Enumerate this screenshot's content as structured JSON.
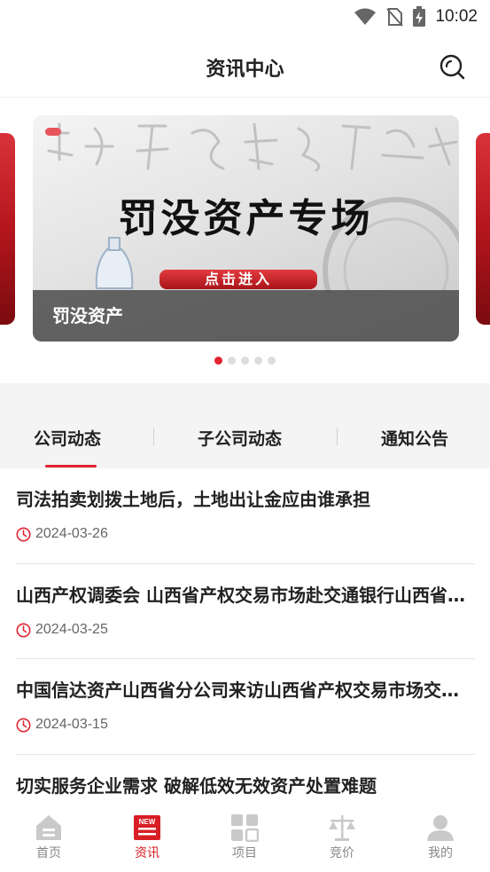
{
  "status_bar": {
    "time": "10:02"
  },
  "header": {
    "title": "资讯中心"
  },
  "banner": {
    "headline": "罚没资产专场",
    "button_text": "点击进入",
    "caption": "罚没资产",
    "slide_count": 5,
    "active_slide": 1
  },
  "tabs": [
    {
      "label": "公司动态",
      "active": true
    },
    {
      "label": "子公司动态",
      "active": false
    },
    {
      "label": "通知公告",
      "active": false
    }
  ],
  "news": [
    {
      "title": "司法拍卖划拨土地后，土地出让金应由谁承担",
      "date": "2024-03-26"
    },
    {
      "title": "山西产权调委会 山西省产权交易市场赴交通银行山西省分行",
      "date": "2024-03-25"
    },
    {
      "title": "中国信达资产山西省分公司来访山西省产权交易市场交流座谈",
      "date": "2024-03-15"
    },
    {
      "title": "切实服务企业需求 破解低效无效资产处置难题",
      "date": ""
    }
  ],
  "tabbar": [
    {
      "label": "首页",
      "icon": "home-icon",
      "active": false
    },
    {
      "label": "资讯",
      "icon": "news-icon",
      "active": true
    },
    {
      "label": "项目",
      "icon": "grid-icon",
      "active": false
    },
    {
      "label": "竞价",
      "icon": "scale-icon",
      "active": false
    },
    {
      "label": "我的",
      "icon": "user-icon",
      "active": false
    }
  ],
  "colors": {
    "accent": "#e02430",
    "tabbar_active": "#d81e25",
    "inactive": "#888888"
  }
}
